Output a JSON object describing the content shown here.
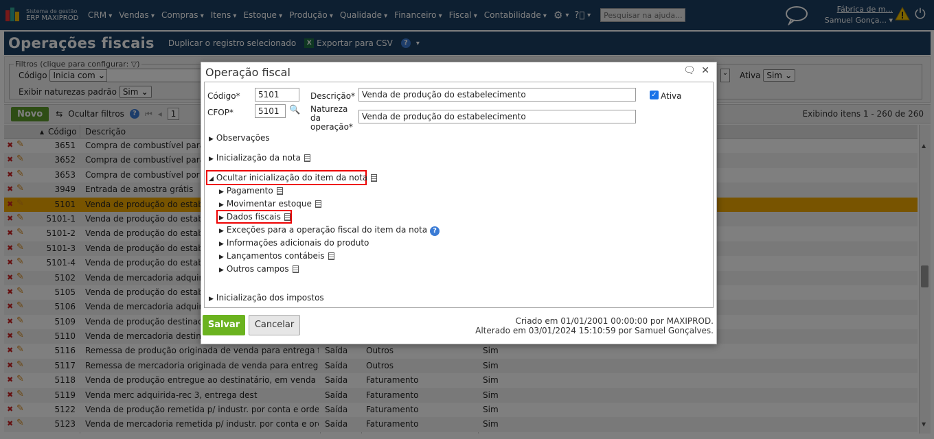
{
  "header": {
    "brand_line1": "Sistema de gestão",
    "brand_line2": "ERP MAXIPROD",
    "menu": [
      "CRM",
      "Vendas",
      "Compras",
      "Itens",
      "Estoque",
      "Produção",
      "Qualidade",
      "Financeiro",
      "Fiscal",
      "Contabilidade"
    ],
    "search_placeholder": "Pesquisar na ajuda...",
    "company": "Fábrica de m...",
    "user": "Samuel Gonça..."
  },
  "page": {
    "title": "Operações fiscais",
    "duplicate_link": "Duplicar o registro selecionado",
    "export_link": "Exportar para CSV"
  },
  "filters": {
    "legend": "Filtros (clique para configurar:",
    "codigo_label": "Código",
    "codigo_mode": "Inicia com",
    "ativa_label": "Ativa",
    "ativa_value": "Sim",
    "natureza_label": "Exibir naturezas padrão",
    "natureza_value": "Sim"
  },
  "toolbar": {
    "novo": "Novo",
    "ocultar_filtros": "Ocultar filtros",
    "page_num": "1",
    "showing": "Exibindo itens 1 - 260 de 260"
  },
  "grid": {
    "col_codigo": "Código",
    "col_descricao": "Descrição",
    "rows": [
      {
        "codigo": "3651",
        "descricao": "Compra de combustível para ir",
        "tipo": "",
        "natureza": "",
        "ativa": ""
      },
      {
        "codigo": "3652",
        "descricao": "Compra de combustível para cc",
        "tipo": "",
        "natureza": "",
        "ativa": ""
      },
      {
        "codigo": "3653",
        "descricao": "Compra de combustível por cor",
        "tipo": "",
        "natureza": "",
        "ativa": ""
      },
      {
        "codigo": "3949",
        "descricao": "Entrada de amostra grátis",
        "tipo": "",
        "natureza": "",
        "ativa": ""
      },
      {
        "codigo": "5101",
        "descricao": "Venda de produção do estabele",
        "tipo": "",
        "natureza": "",
        "ativa": ""
      },
      {
        "codigo": "5101-1",
        "descricao": "Venda de produção do estabele",
        "tipo": "",
        "natureza": "",
        "ativa": ""
      },
      {
        "codigo": "5101-2",
        "descricao": "Venda de produção do estabele",
        "tipo": "",
        "natureza": "",
        "ativa": ""
      },
      {
        "codigo": "5101-3",
        "descricao": "Venda de produção do estabele",
        "tipo": "",
        "natureza": "",
        "ativa": ""
      },
      {
        "codigo": "5101-4",
        "descricao": "Venda de produção do estabele",
        "tipo": "",
        "natureza": "",
        "ativa": ""
      },
      {
        "codigo": "5102",
        "descricao": "Venda de mercadoria adquirida",
        "tipo": "",
        "natureza": "",
        "ativa": ""
      },
      {
        "codigo": "5105",
        "descricao": "Venda de produção do estabele",
        "tipo": "",
        "natureza": "",
        "ativa": ""
      },
      {
        "codigo": "5106",
        "descricao": "Venda de mercadoria adquirida",
        "tipo": "",
        "natureza": "",
        "ativa": ""
      },
      {
        "codigo": "5109",
        "descricao": "Venda de produção destinada à",
        "tipo": "",
        "natureza": "",
        "ativa": ""
      },
      {
        "codigo": "5110",
        "descricao": "Venda de mercadoria destinad",
        "tipo": "",
        "natureza": "",
        "ativa": ""
      },
      {
        "codigo": "5116",
        "descricao": "Remessa de produção originada de venda para entrega futura",
        "tipo": "Saída",
        "natureza": "Outros",
        "ativa": "Sim"
      },
      {
        "codigo": "5117",
        "descricao": "Remessa de mercadoria originada de venda para entrega fut...",
        "tipo": "Saída",
        "natureza": "Outros",
        "ativa": "Sim"
      },
      {
        "codigo": "5118",
        "descricao": "Venda de produção entregue ao destinatário, em venda à or...",
        "tipo": "Saída",
        "natureza": "Faturamento",
        "ativa": "Sim"
      },
      {
        "codigo": "5119",
        "descricao": "Venda merc adquirida-rec 3, entrega dest",
        "tipo": "Saída",
        "natureza": "Faturamento",
        "ativa": "Sim"
      },
      {
        "codigo": "5122",
        "descricao": "Venda de produção remetida p/ industr. por conta e ordem",
        "tipo": "Saída",
        "natureza": "Faturamento",
        "ativa": "Sim"
      },
      {
        "codigo": "5123",
        "descricao": "Venda de mercadoria remetida p/ industr. por conta e ordem",
        "tipo": "Saída",
        "natureza": "Faturamento",
        "ativa": "Sim"
      }
    ]
  },
  "dialog": {
    "title": "Operação fiscal",
    "codigo_label": "Código*",
    "codigo_value": "5101",
    "cfop_label": "CFOP*",
    "cfop_value": "5101",
    "descricao_label": "Descrição*",
    "descricao_value": "Venda de produção do estabelecimento",
    "natureza_label_1": "Natureza",
    "natureza_label_2": "da",
    "natureza_label_3": "operação*",
    "natureza_value": "Venda de produção do estabelecimento",
    "ativa_label": "Ativa",
    "sections": {
      "observacoes": "Observações",
      "inicializacao_nota": "Inicialização da nota",
      "ocultar_item": "Ocultar inicialização do item da nota",
      "pagamento": "Pagamento",
      "movimentar_estoque": "Movimentar estoque",
      "dados_fiscais": "Dados fiscais",
      "excecoes": "Exceções para a operação fiscal do item da nota",
      "info_adicionais": "Informações adicionais do produto",
      "lancamentos": "Lançamentos contábeis",
      "outros_campos": "Outros campos",
      "inicializacao_impostos": "Inicialização dos impostos"
    },
    "save": "Salvar",
    "cancel": "Cancelar",
    "created": "Criado em 01/01/2001 00:00:00 por MAXIPROD.",
    "altered": "Alterado em 03/01/2024 15:10:59 por Samuel Gonçalves."
  }
}
